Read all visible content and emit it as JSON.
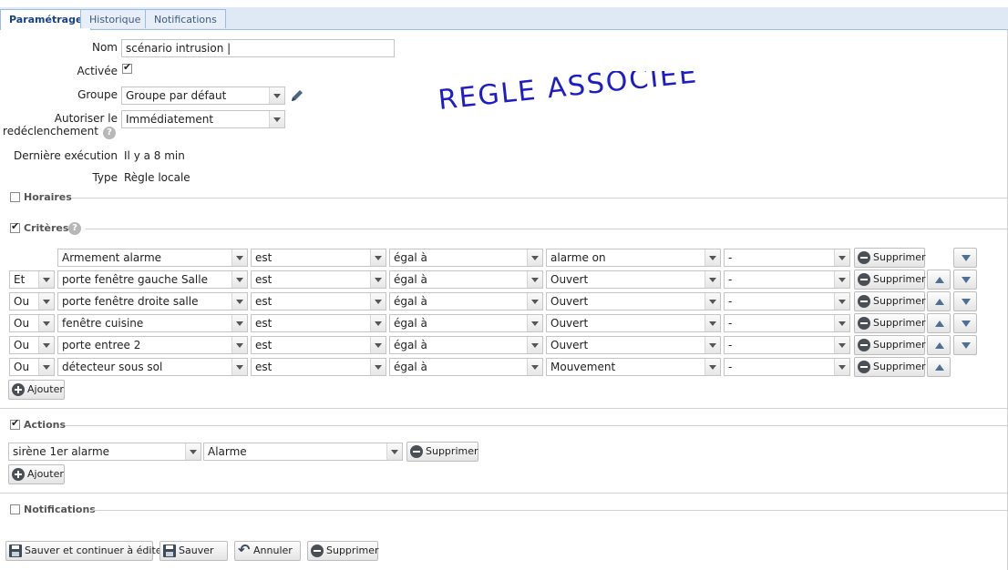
{
  "tabs": [
    {
      "label": "Paramétrage",
      "active": true
    },
    {
      "label": "Historique",
      "active": false
    },
    {
      "label": "Notifications",
      "active": false
    }
  ],
  "form": {
    "nom_label": "Nom",
    "nom_value": "scénario intrusion |",
    "activee_label": "Activée",
    "activee_checked": true,
    "groupe_label": "Groupe",
    "groupe_value": "Groupe par défaut",
    "autoriser_label_1": "Autoriser le",
    "autoriser_label_2": "redéclenchement",
    "autoriser_value": "Immédiatement",
    "derniere_label": "Dernière exécution",
    "derniere_value": "Il y a 8 min",
    "type_label": "Type",
    "type_value": "Règle locale"
  },
  "sections": {
    "horaires": {
      "title": "Horaires",
      "checked": false
    },
    "criteres": {
      "title": "Critères",
      "checked": true
    },
    "actions": {
      "title": "Actions",
      "checked": true
    },
    "notifications": {
      "title": "Notifications",
      "checked": false
    }
  },
  "criteria": [
    {
      "connector": "",
      "device": "Armement alarme",
      "op": "est",
      "cmp": "égal à",
      "value": "alarme on",
      "extra": "-",
      "up": false,
      "down": true
    },
    {
      "connector": "Et",
      "device": "porte fenêtre gauche Salle",
      "op": "est",
      "cmp": "égal à",
      "value": "Ouvert",
      "extra": "-",
      "up": true,
      "down": true
    },
    {
      "connector": "Ou",
      "device": "porte fenêtre droite salle",
      "op": "est",
      "cmp": "égal à",
      "value": "Ouvert",
      "extra": "-",
      "up": true,
      "down": true
    },
    {
      "connector": "Ou",
      "device": "fenêtre cuisine",
      "op": "est",
      "cmp": "égal à",
      "value": "Ouvert",
      "extra": "-",
      "up": true,
      "down": true
    },
    {
      "connector": "Ou",
      "device": "porte entree 2",
      "op": "est",
      "cmp": "égal à",
      "value": "Ouvert",
      "extra": "-",
      "up": true,
      "down": true
    },
    {
      "connector": "Ou",
      "device": "détecteur sous sol",
      "op": "est",
      "cmp": "égal à",
      "value": "Mouvement",
      "extra": "-",
      "up": true,
      "down": false
    }
  ],
  "actions": [
    {
      "device": "sirène 1er alarme",
      "value": "Alarme"
    }
  ],
  "buttons": {
    "supprimer": "Supprimer",
    "ajouter": "Ajouter",
    "save_continue": "Sauver et continuer à éditer",
    "save": "Sauver",
    "cancel": "Annuler",
    "delete": "Supprimer"
  },
  "annotation": "REGLE ASSOCIEE"
}
